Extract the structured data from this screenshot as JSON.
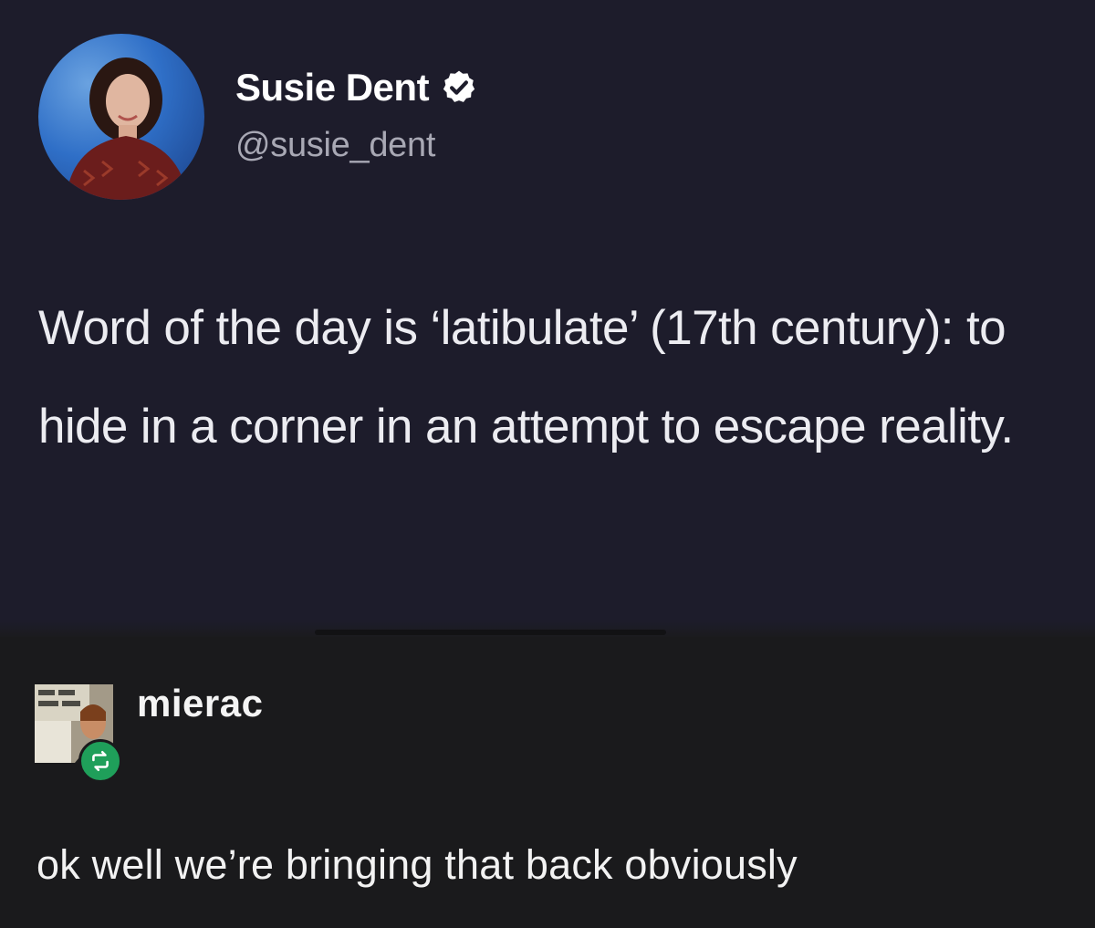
{
  "tweet": {
    "display_name": "Susie Dent",
    "verified_icon": "verified-badge-icon",
    "handle": "@susie_dent",
    "text": "Word of the day is ‘latibulate’ (17th century): to hide in a corner in an attempt to escape reality."
  },
  "reblog": {
    "username": "mierac",
    "badge_icon": "reblog-icon",
    "text": "ok well we’re bringing that back obviously"
  },
  "colors": {
    "tweet_background": "#1d1c2b",
    "reblog_background": "#1a1a1c",
    "reblog_badge": "#1f9f5a",
    "handle_text": "#a8a8b4"
  }
}
